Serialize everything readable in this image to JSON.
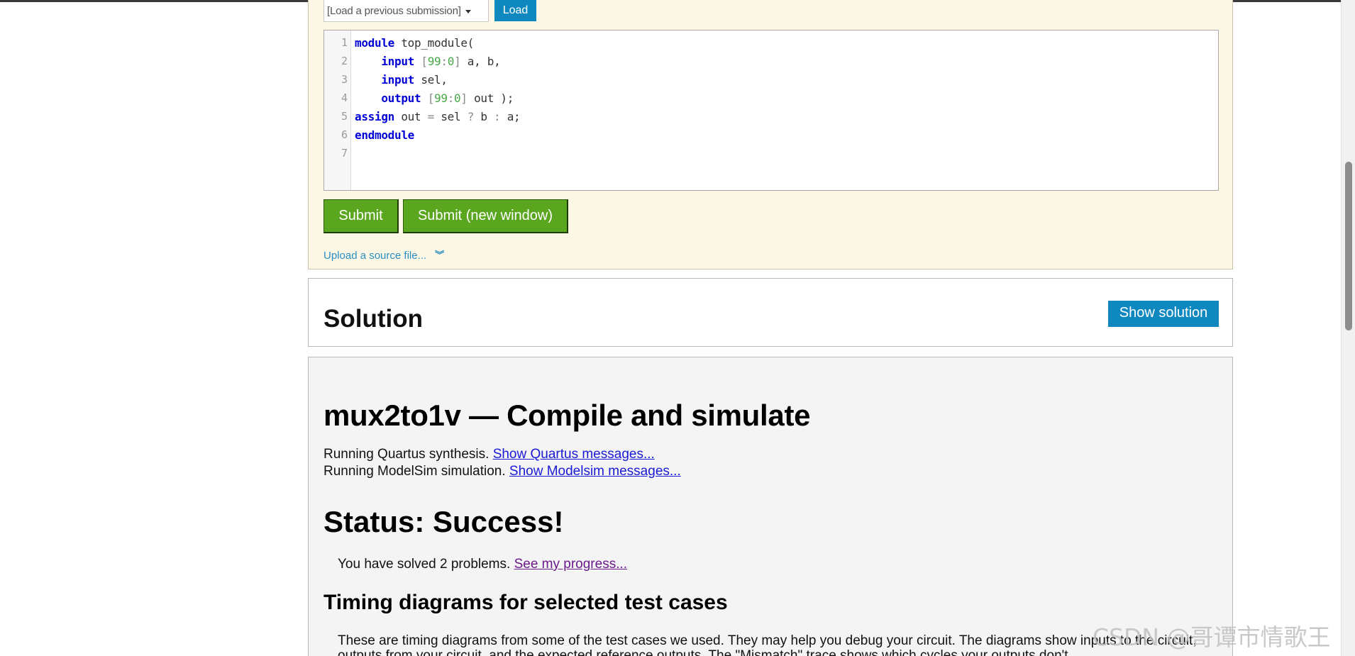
{
  "submission": {
    "load_select_value": "[Load a previous submission]",
    "load_label": "Load",
    "code_lines": [
      {
        "n": "1",
        "parts": [
          [
            "kw",
            "module"
          ],
          [
            "",
            " top_module("
          ]
        ]
      },
      {
        "n": "2",
        "parts": [
          [
            "",
            "    "
          ],
          [
            "kw",
            "input"
          ],
          [
            "",
            " "
          ],
          [
            "op",
            "["
          ],
          [
            "num",
            "99"
          ],
          [
            "op",
            ":"
          ],
          [
            "num",
            "0"
          ],
          [
            "op",
            "]"
          ],
          [
            "",
            " a, b,"
          ]
        ]
      },
      {
        "n": "3",
        "parts": [
          [
            "",
            "    "
          ],
          [
            "kw",
            "input"
          ],
          [
            "",
            " sel,"
          ]
        ]
      },
      {
        "n": "4",
        "parts": [
          [
            "",
            "    "
          ],
          [
            "kw",
            "output"
          ],
          [
            "",
            " "
          ],
          [
            "op",
            "["
          ],
          [
            "num",
            "99"
          ],
          [
            "op",
            ":"
          ],
          [
            "num",
            "0"
          ],
          [
            "op",
            "]"
          ],
          [
            "",
            " out );"
          ]
        ]
      },
      {
        "n": "5",
        "parts": [
          [
            "kw",
            "assign"
          ],
          [
            "",
            " out "
          ],
          [
            "op",
            "="
          ],
          [
            "",
            " sel "
          ],
          [
            "op",
            "?"
          ],
          [
            "",
            " b "
          ],
          [
            "op",
            ":"
          ],
          [
            "",
            " a;"
          ]
        ]
      },
      {
        "n": "6",
        "parts": [
          [
            "kw",
            "endmodule"
          ]
        ]
      },
      {
        "n": "7",
        "parts": []
      }
    ],
    "submit_label": "Submit",
    "submit_new_label": "Submit (new window)",
    "upload_label": "Upload a source file...",
    "upload_icon": "double-chevron-down-icon"
  },
  "solution": {
    "title": "Solution",
    "show_label": "Show solution"
  },
  "results": {
    "title": "mux2to1v — Compile and simulate",
    "quartus_text": "Running Quartus synthesis. ",
    "quartus_link": "Show Quartus messages...",
    "modelsim_text": "Running ModelSim simulation. ",
    "modelsim_link": "Show Modelsim messages...",
    "status_title": "Status: Success!",
    "progress_text": "You have solved 2 problems. ",
    "progress_link": "See my progress...",
    "timing_title": "Timing diagrams for selected test cases",
    "timing_text": "These are timing diagrams from some of the test cases we used. They may help you debug your circuit. The diagrams show inputs to the circuit, outputs from your circuit, and the expected reference outputs. The \"Mismatch\" trace shows which cycles your outputs don't"
  },
  "watermark": "CSDN @哥谭市情歌王"
}
